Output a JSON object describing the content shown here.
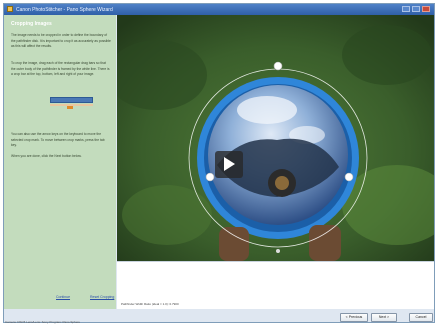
{
  "window": {
    "title": "Canon PhotoStitcher - Pano Sphere Wizard",
    "colors": {
      "titlebar": "#3a69b3",
      "sidebar": "#c3dcbd",
      "link": "#2a4fa8"
    }
  },
  "sidebar": {
    "heading": "Cropping Images",
    "paragraph1": "The image needs to be cropped in order to define the boundary of the pathfinder disk. It is important to crop it as accurately as possible as this will affect the results.",
    "paragraph2": "To crop the image, drag each of the rectangular drag bars so that the outer body of the pathfinder is framed by the white line. There is a crop bar at the top, bottom, left and right of your image.",
    "paragraph3": "You can also use the arrow keys on the keyboard to move the selected crop mark. To move between crop marks, press the tab key.",
    "paragraph4": "When you are done, click the Next button below.",
    "link_left": "Continue",
    "link_right": "Reset Cropping"
  },
  "viewer": {
    "play_icon": "play-icon",
    "caption": "Pathfinder Width Ratio (ideal = 1.0): 0.7900"
  },
  "buttons": {
    "previous": "< Previous",
    "next": "Next >",
    "cancel": "Cancel"
  },
  "status_bar": {
    "text": "Camera: DSC5  Lens/Lens: Sony  Program: Pano Sphere"
  }
}
